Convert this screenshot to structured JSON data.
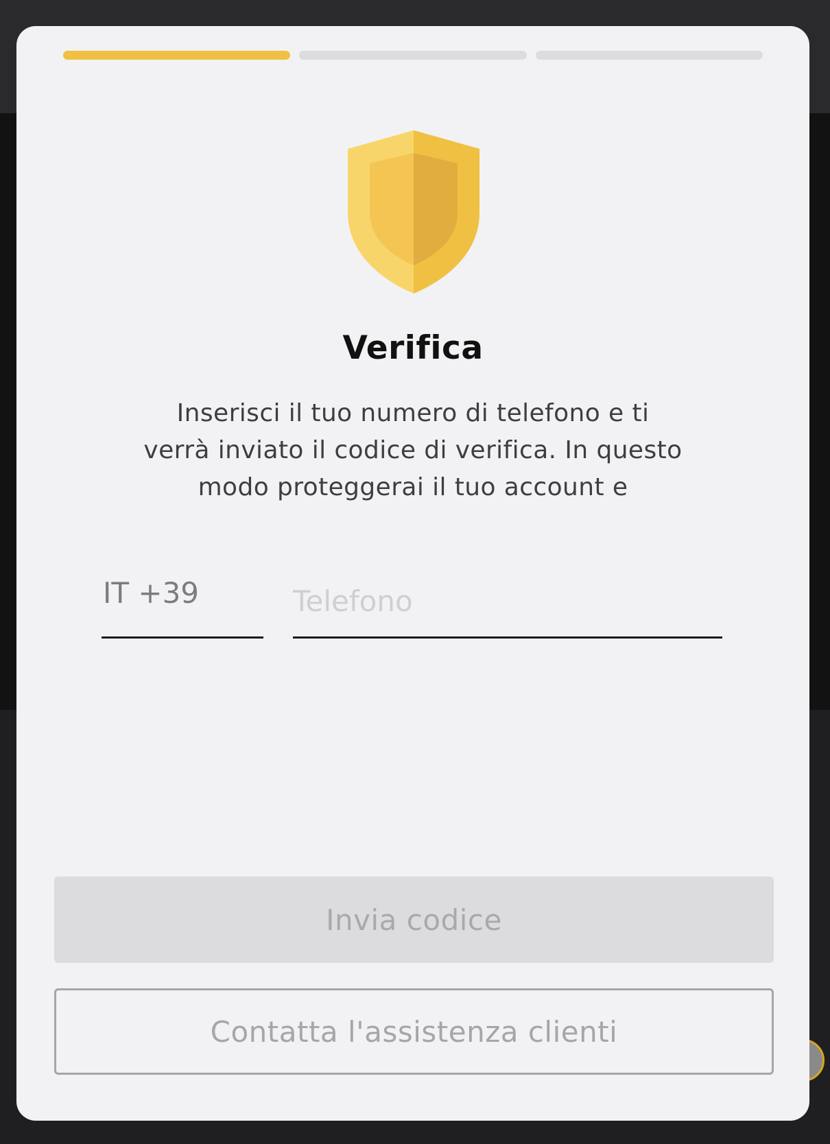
{
  "progress": {
    "total_steps": 3,
    "current_step": 1,
    "active_color": "#f0c042",
    "inactive_color": "#dcdcde"
  },
  "icon": {
    "name": "shield-icon",
    "colors": [
      "#f8d56a",
      "#f0c042",
      "#e2ad3f"
    ]
  },
  "dialog": {
    "title": "Verifica",
    "description_lines": [
      "Inserisci il tuo numero di telefono e ti",
      "verrà inviato il codice di verifica. In questo",
      "modo proteggerai il tuo account e"
    ]
  },
  "form": {
    "country_code": "IT +39",
    "phone_placeholder": "Telefono",
    "phone_value": ""
  },
  "actions": {
    "send_code_label": "Invia codice",
    "send_code_enabled": false,
    "support_label": "Contatta l'assistenza clienti"
  }
}
